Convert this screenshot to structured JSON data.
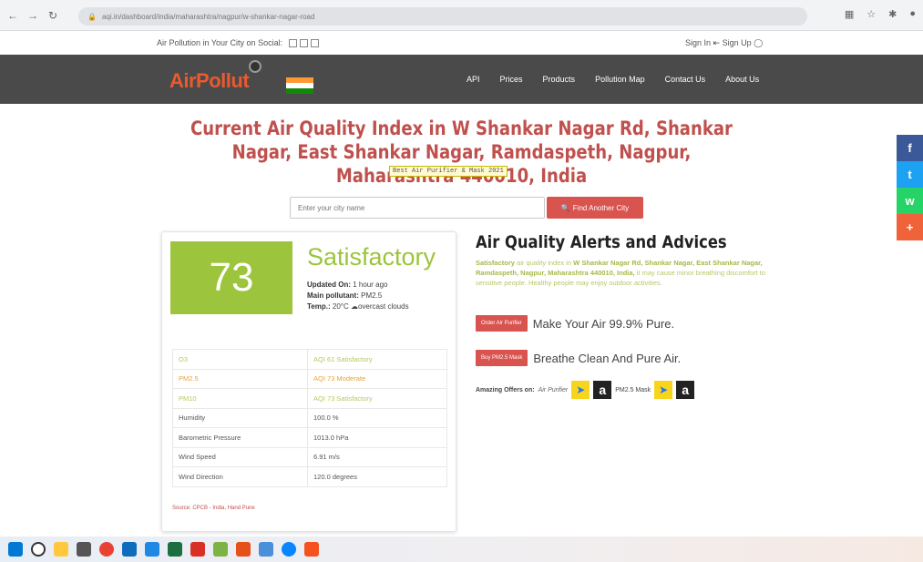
{
  "browser": {
    "url": "aqi.in/dashboard/india/maharashtra/nagpur/w-shankar-nagar-road"
  },
  "topstrip": {
    "social_text": "Air Pollution in Your City on Social:",
    "sign_in": "Sign In",
    "sign_up": "Sign Up"
  },
  "navbar": {
    "logo": "AirPollut",
    "links": [
      "API",
      "Prices",
      "Products",
      "Pollution Map",
      "Contact Us",
      "About Us"
    ]
  },
  "main": {
    "title": "Current Air Quality Index in W Shankar Nagar Rd, Shankar Nagar, East Shankar Nagar, Ramdaspeth, Nagpur, Maharashtra 440010, India",
    "ad": "Best Air Purifier & Mask 2021"
  },
  "search": {
    "placeholder": "Enter your city name",
    "button": "Find Another City"
  },
  "card": {
    "aqi": "73",
    "category": "Satisfactory",
    "updated_label": "Updated On:",
    "updated_value": "1 hour ago",
    "pollutant_label": "Main pollutant:",
    "pollutant_value": "PM2.5",
    "temp_label": "Temp.:",
    "temp_value": "20°C",
    "weather": "overcast clouds",
    "rows": [
      {
        "name": "O3",
        "value": "AQI 61   Satisfactory"
      },
      {
        "name": "PM2.5",
        "value": "AQI 73   Moderate"
      },
      {
        "name": "PM10",
        "value": "AQI 73   Satisfactory"
      },
      {
        "name": "Humidity",
        "value": "100.0 %"
      },
      {
        "name": "Barometric Pressure",
        "value": "1013.0 hPa"
      },
      {
        "name": "Wind Speed",
        "value": "6.91 m/s"
      },
      {
        "name": "Wind Direction",
        "value": "120.0 degrees"
      }
    ],
    "source": "Source: CPCB - India, Hand Pune"
  },
  "alerts": {
    "title": "Air Quality Alerts and Advices",
    "text_lead": "Satisfactory",
    "text_mid": "air quality index in",
    "text_place": "W Shankar Nagar Rd, Shankar Nagar, East Shankar Nagar, Ramdaspeth, Nagpur, Maharashtra 440010, India,",
    "text_tail": "it may cause minor breathing discomfort to sensitive people. Healthy people may enjoy outdoor activities.",
    "cta1_button": "Order Air Purifier",
    "cta1_text": "Make Your Air 99.9% Pure.",
    "cta2_button": "Buy PM2.5 Mask",
    "cta2_text": "Breathe Clean And Pure Air.",
    "offers_label": "Amazing Offers on:",
    "offers_item1": "Air Purifier",
    "offers_item2": "PM2.5 Mask"
  },
  "share": {
    "facebook": "f",
    "twitter": "t",
    "whatsapp": "w",
    "more": "+"
  },
  "colors": {
    "accent_red": "#d9534f",
    "aqi_green": "#9cc43c",
    "nav_bg": "#4a4a4a"
  }
}
